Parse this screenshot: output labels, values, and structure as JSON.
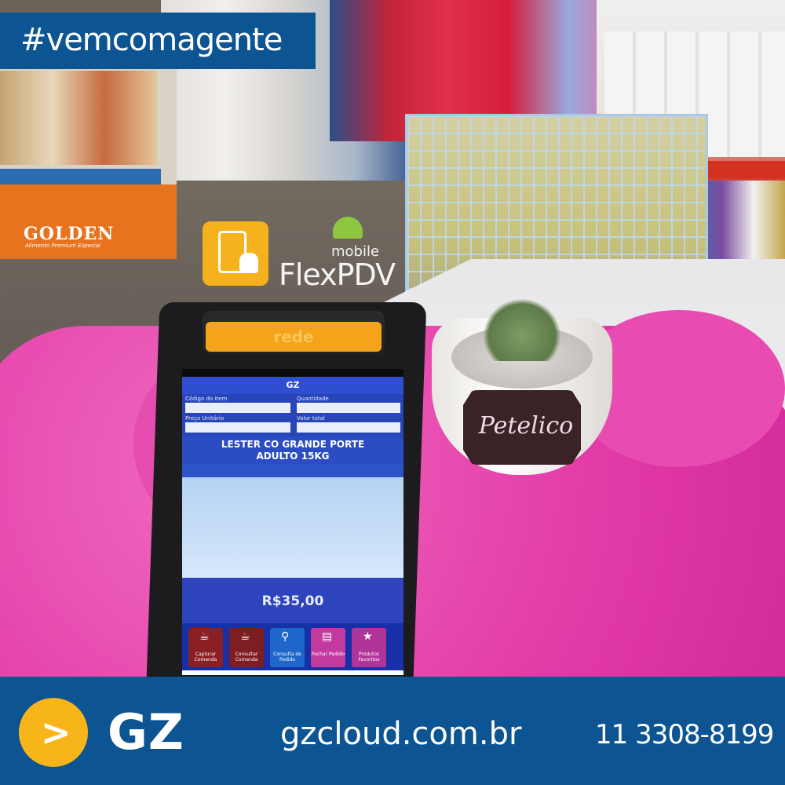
{
  "hashtag": "#vemcomagente",
  "scene": {
    "golden_brand": "GOLDEN",
    "golden_tagline": "Alimento Premium Especial",
    "pot_label": "Petelico",
    "printer_brand": "rede"
  },
  "app_logo": {
    "mobile_label": "mobile",
    "name": "FlexPDV"
  },
  "pos_screen": {
    "app_title": "GZ",
    "fields": [
      "Código do item",
      "Quantidade",
      "Preço Unitário",
      "Valor total"
    ],
    "product_line1": "LESTER CO GRANDE PORTE",
    "product_line2": "ADULTO 15KG",
    "total": "R$35,00",
    "toolbar": [
      {
        "label": "Capturar Comanda",
        "icon": "cup-icon"
      },
      {
        "label": "Consultar Comanda",
        "icon": "cup-icon"
      },
      {
        "label": "Consulta de Pedido",
        "icon": "search-icon"
      },
      {
        "label": "Fechar Pedido",
        "icon": "document-icon"
      },
      {
        "label": "Produtos Favoritos",
        "icon": "star-icon"
      }
    ]
  },
  "footer": {
    "brand": "GZ",
    "website": "gzcloud.com.br",
    "phone": "11 3308-8199"
  },
  "colors": {
    "brand_blue": "#0d5493",
    "brand_yellow": "#f8b51a",
    "mat_pink": "#e23aa6"
  }
}
